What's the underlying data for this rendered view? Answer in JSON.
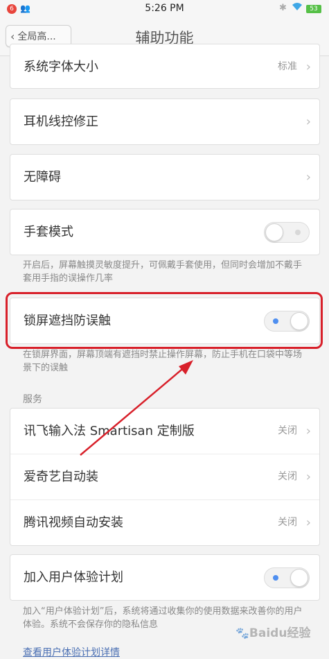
{
  "status_bar": {
    "notification_count": "6",
    "time": "5:26 PM",
    "battery": "53",
    "icons": [
      "user-icon",
      "bluetooth-icon",
      "wifi-icon",
      "battery-icon"
    ]
  },
  "nav": {
    "back_label": "全局高...",
    "title": "辅助功能"
  },
  "rows": {
    "font_size": {
      "label": "系统字体大小",
      "value": "标准"
    },
    "earphone": {
      "label": "耳机线控修正"
    },
    "accessibility": {
      "label": "无障碍"
    },
    "glove_mode": {
      "label": "手套模式",
      "state": "off",
      "desc": "开启后，屏幕触摸灵敏度提升，可佩戴手套使用，但同时会增加不戴手套用手指的误操作几率"
    },
    "lockscreen": {
      "label": "锁屏遮挡防误触",
      "state": "on",
      "desc": "在锁屏界面，屏幕顶端有遮挡时禁止操作屏幕，防止手机在口袋中等场景下的误触"
    }
  },
  "services": {
    "header": "服务",
    "items": [
      {
        "label": "讯飞输入法 Smartisan 定制版",
        "value": "关闭"
      },
      {
        "label": "爱奇艺自动装",
        "value": "关闭"
      },
      {
        "label": "腾讯视频自动安装",
        "value": "关闭"
      }
    ]
  },
  "experience": {
    "label": "加入用户体验计划",
    "state": "on",
    "desc": "加入“用户体验计划”后，系统将通过收集你的使用数据来改善你的用户体验。系统不会保存你的隐私信息",
    "link": "查看用户体验计划详情"
  },
  "watermark": "Baidu经验",
  "colors": {
    "accent": "#4f8ff0",
    "highlight": "#d8202a",
    "link": "#4a6fb3",
    "battery": "#56c047",
    "badge": "#e8453c"
  }
}
